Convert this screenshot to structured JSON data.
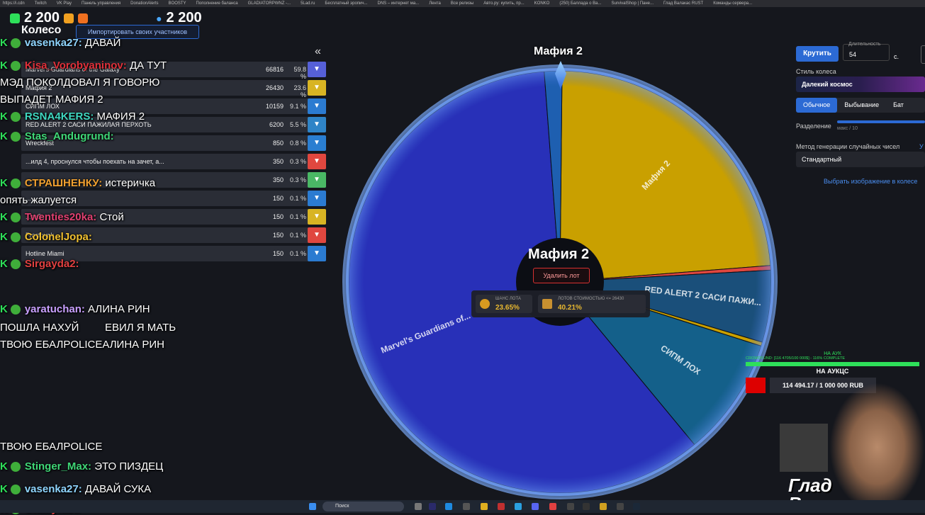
{
  "bookmarks": [
    "https://i.cdn",
    "Twitch",
    "VK Play",
    "Панель управления",
    "DonationAlerts",
    "BOOSTY",
    "Пополнение баланса",
    "GLADIATORPWNZ -...",
    "5Lad.ru",
    "Бесплатный эропич...",
    "DNS – интернет ма...",
    "Лента",
    "Все релизы",
    "Авто.ру: купить, пр...",
    "KONKO",
    "(250) Баллада о Ва...",
    "SurvivalShop | Пане...",
    "Глад Валакас RUST",
    "Команды сервера..."
  ],
  "stats": {
    "left_count": "2 200",
    "right_count": "2 200"
  },
  "app": {
    "title": "Колесо",
    "import_button": "Импортировать своих участников",
    "collapse_icon": "«"
  },
  "lots": [
    {
      "name": "Marvel's Guardians of the Galaxy",
      "amount": "66816",
      "percent": "59.8 %",
      "color": "#5660d8"
    },
    {
      "name": "Мафия 2",
      "amount": "26430",
      "percent": "23.6 %",
      "color": "#d8b423"
    },
    {
      "name": "СИПМ ЛОХ",
      "amount": "10159",
      "percent": "9.1 %",
      "color": "#2b7bd1"
    },
    {
      "name": "RED ALERT 2 САСИ ПАЖИЛАЯ ПЕРХОТЬ",
      "amount": "6200",
      "percent": "5.5 %",
      "color": "#2f84c7"
    },
    {
      "name": "Wreckfest",
      "amount": "850",
      "percent": "0.8 %",
      "color": "#2a7ed1"
    },
    {
      "name": "...илд 4, проснулся чтобы поехать на зачет, а...",
      "amount": "350",
      "percent": "0.3 %",
      "color": "#e0473f"
    },
    {
      "name": "...",
      "amount": "350",
      "percent": "0.3 %",
      "color": "#4ab865"
    },
    {
      "name": "...",
      "amount": "150",
      "percent": "0.1 %",
      "color": "#2b7bd1"
    },
    {
      "name": "...тебя",
      "amount": "150",
      "percent": "0.1 %",
      "color": "#d8b423"
    },
    {
      "name": "Frostpunk",
      "amount": "150",
      "percent": "0.1 %",
      "color": "#e0473f"
    },
    {
      "name": "Hotline Miami",
      "amount": "150",
      "percent": "0.1 %",
      "color": "#2b7bd1"
    }
  ],
  "chat": [
    {
      "user": "vasenka27:",
      "user_color": "#8fd5ff",
      "text": "ДАВАЙ"
    },
    {
      "user": "Kisa_Vorobyaninov:",
      "user_color": "#e0303a",
      "text": "ДА ТУТ"
    },
    {
      "user": "",
      "user_color": "#fff",
      "text": "МЭД ПОКОЛДОВАЛ Я ГОВОРЮ"
    },
    {
      "user": "",
      "user_color": "#fff",
      "text": "ВЫПАДЕТ МАФИЯ 2"
    },
    {
      "user": "RSNA4KERS:",
      "user_color": "#3fd7c0",
      "text": "МАФИЯ 2"
    },
    {
      "user": "Stas_Andugrund:",
      "user_color": "#3fd777",
      "text": ""
    },
    {
      "user": "СТРАШНЕНКУ:",
      "user_color": "#f0a030",
      "text": "истеричка"
    },
    {
      "user": "",
      "user_color": "#fff",
      "text": "опять жалуется"
    },
    {
      "user": "Twenties20ka:",
      "user_color": "#e04070",
      "text": "Стой"
    },
    {
      "user": "ColonelJopa:",
      "user_color": "#f0c030",
      "text": ""
    },
    {
      "user": "Sirgayda2:",
      "user_color": "#e04040",
      "text": ""
    },
    {
      "user": "yaratuchan:",
      "user_color": "#c9a0ff",
      "text": "АЛИНА РИН"
    },
    {
      "user": "",
      "user_color": "#fff",
      "text": "ПОШЛА НАХУЙ"
    },
    {
      "user": "",
      "user_color": "#fff",
      "text": "ЕВИЛ Я МАТЬ"
    },
    {
      "user": "",
      "user_color": "#fff",
      "text": "ТВОЮ ЕБАЛPOLICEАЛИНА РИН"
    },
    {
      "user": "",
      "user_color": "#fff",
      "text": "ТВОЮ ЕБАЛPOLICE"
    },
    {
      "user": "Stinger_Max:",
      "user_color": "#3fd777",
      "text": "ЭТО ПИЗДЕЦ"
    },
    {
      "user": "vasenka27:",
      "user_color": "#8fd5ff",
      "text": "ДАВАЙ СУКА"
    },
    {
      "user": "OldIllyrian:",
      "user_color": "#e04040",
      "text": ""
    }
  ],
  "wheel": {
    "pointer_label": "Мафия 2",
    "center_title": "Мафия 2",
    "delete_button": "Удалить лот",
    "chance_label": "ШАНС ЛОТА",
    "chance_value": "23.65%",
    "cost_label": "ЛОТОВ СТОИМОСТЬЮ <= 26430",
    "cost_value": "40.21%",
    "slices": [
      {
        "label": "Мафия 2",
        "fraction": 0.236,
        "color": "#c9a000"
      },
      {
        "label": "",
        "fraction": 0.0035,
        "color": "#e0473f"
      },
      {
        "label": "RED ALERT 2 САСИ ПАЖИ...",
        "fraction": 0.055,
        "color": "#1a4f7a"
      },
      {
        "label": "",
        "fraction": 0.003,
        "color": "#c9a000"
      },
      {
        "label": "СИПМ ЛОХ",
        "fraction": 0.091,
        "color": "#14608a"
      },
      {
        "label": "Marvel's Guardians of...",
        "fraction": 0.598,
        "color": "#2830b8"
      },
      {
        "label": "",
        "fraction": 0.0135,
        "color": "#1e5fb0"
      }
    ]
  },
  "settings": {
    "spin_button": "Крутить",
    "duration_label": "Длительность",
    "duration_value": "54",
    "duration_unit": "с.",
    "style_label": "Стиль колеса",
    "style_value": "Далекий космос",
    "modes": [
      "Обычное",
      "Выбывание",
      "Бат"
    ],
    "split_label": "Разделение",
    "split_hint": "макс / 10",
    "rng_label": "Метод генерации случайных чисел",
    "rng_value": "Стандартный",
    "rng_link": "У",
    "image_link": "Выбрать изображение в колесе"
  },
  "auction": {
    "top": "НА АУК",
    "crowdfund": "CROWDFUND: [116 4705/100 000$] - 116% COMPLETE",
    "title": "НА АУКЦС",
    "amount": "114 494.17 / 1 000 000 RUB"
  },
  "streamer": {
    "line1": "Глад",
    "line2": "Валакас"
  },
  "taskbar": {
    "search": "Поиск"
  }
}
